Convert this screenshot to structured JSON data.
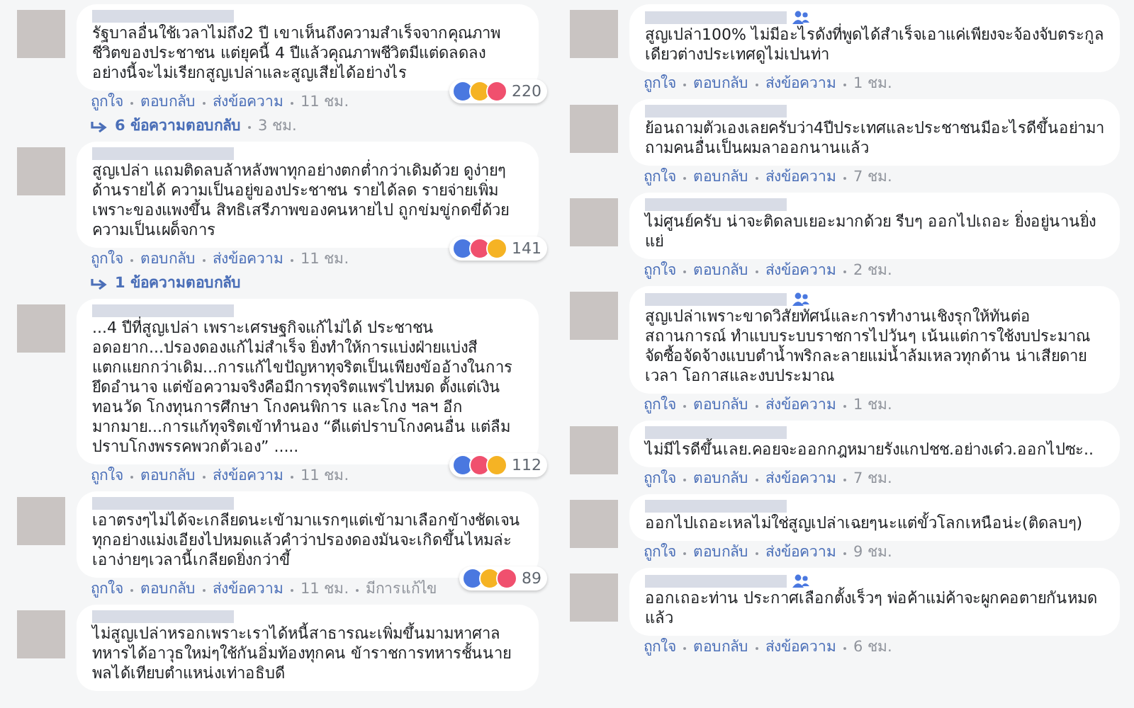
{
  "columns": [
    {
      "comments": [
        {
          "text": "รัฐบาลอื่นใช้เวลาไม่ถึง2 ปี เขาเห็นถึงความสำเร็จจากคุณภาพชีวิตของประชาชน แต่ยุคนี้ 4 ปีแล้วคุณภาพชีวิตมีแต่ดลดลง อย่างนี้จะไม่เรียกสูญเปล่าและสูญเสียได้อย่างไร",
          "member_badge": false,
          "reactions": [
            {
              "kind": "like"
            },
            {
              "kind": "haha"
            },
            {
              "kind": "love"
            }
          ],
          "reaction_count": "220",
          "actions": [
            "ถูกใจ",
            "ตอบกลับ",
            "ส่งข้อความ"
          ],
          "time": "11 ชม.",
          "replies": {
            "label": "6 ข้อความตอบกลับ",
            "time": "3 ชม."
          }
        },
        {
          "text": "สูญเปล่า แถมติดลบล้าหลังพาทุกอย่างตกต่ำกว่าเดิมด้วย ดูง่ายๆด้านรายได้ ความเป็นอยู่ของประชาชน รายได้ลด รายจ่ายเพิ่มเพราะของแพงขึ้น สิทธิเสรีภาพของคนหายไป ถูกข่มขู่กดขี่ด้วยความเป็นเผด็จการ",
          "member_badge": false,
          "reactions": [
            {
              "kind": "like"
            },
            {
              "kind": "love"
            },
            {
              "kind": "haha"
            }
          ],
          "reaction_count": "141",
          "actions": [
            "ถูกใจ",
            "ตอบกลับ",
            "ส่งข้อความ"
          ],
          "time": "11 ชม.",
          "replies": {
            "label": "1 ข้อความตอบกลับ"
          }
        },
        {
          "text": "...4 ปีที่สูญเปล่า เพราะเศรษฐกิจแก้ไม่ได้ ประชาชนอดอยาก...ปรองดองแก้ไม่สำเร็จ ยิ่งทำให้การแบ่งฝ่ายแบ่งสี แตกแยกกว่าเดิม...การแก้ไขปัญหาทุจริตเป็นเพียงข้ออ้างในการยึดอำนาจ แต่ข้อความจริงคือมีการทุจริตแพร่ไปหมด ตั้งแต่เงินทอนวัด โกงทุนการศึกษา โกงคนพิการ และโกง ฯลฯ อีกมากมาย...การแก้ทุจริตเข้าทำนอง “ดีแต่ปราบโกงคนอื่น แต่ลืมปราบโกงพรรคพวกตัวเอง” .....",
          "member_badge": false,
          "reactions": [
            {
              "kind": "like"
            },
            {
              "kind": "love"
            },
            {
              "kind": "haha"
            }
          ],
          "reaction_count": "112",
          "actions": [
            "ถูกใจ",
            "ตอบกลับ",
            "ส่งข้อความ"
          ],
          "time": "11 ชม."
        },
        {
          "text": "เอาตรงๆไม่ได้จะเกลียดนะเข้ามาแรกๆแต่เข้ามาเลือกข้างชัดเจนทุกอย่างแม่งเอียงไปหมดแล้วคำว่าปรองดองมันจะเกิดขึ้นไหมล่ะเอาง่ายๆเวลานี้เกลียดยิ่งกว่าขี้",
          "member_badge": false,
          "reactions": [
            {
              "kind": "like"
            },
            {
              "kind": "haha"
            },
            {
              "kind": "love"
            }
          ],
          "reaction_count": "89",
          "actions": [
            "ถูกใจ",
            "ตอบกลับ",
            "ส่งข้อความ"
          ],
          "time": "11 ชม.",
          "edited": "มีการแก้ไข"
        },
        {
          "text": "ไม่สูญเปล่าหรอกเพราะเราได้หนี้สาธารณะเพิ่มขึ้นมามหาศาล ทหารได้อาวุธใหม่ๆใช้กันอิ่มท้องทุกคน ข้าราชการทหารชั้นนายพลได้เทียบตำแหน่งเท่าอธิบดี",
          "member_badge": false
        }
      ]
    },
    {
      "comments": [
        {
          "text": "สูญเปล่า100% ไม่มีอะไรดังที่พูดได้สำเร็จเอาแค่เพียงจะจ้องจับตระกูลเดียวต่างประเทศดูไม่เปนท่า",
          "member_badge": true,
          "actions": [
            "ถูกใจ",
            "ตอบกลับ",
            "ส่งข้อความ"
          ],
          "time": "1 ชม."
        },
        {
          "text": "ย้อนถามตัวเองเลยครับว่า4ปีประเทศและประชาชนมีอะไรดีขึ้นอย่ามาถามคนอื่นเป็นผมลาออกนานแล้ว",
          "member_badge": false,
          "actions": [
            "ถูกใจ",
            "ตอบกลับ",
            "ส่งข้อความ"
          ],
          "time": "7 ชม."
        },
        {
          "text": "ไม่ศูนย์ครับ น่าจะติดลบเยอะมากด้วย รีบๆ ออกไปเถอะ ยิ่งอยู่นานยิ่งแย่",
          "member_badge": false,
          "actions": [
            "ถูกใจ",
            "ตอบกลับ",
            "ส่งข้อความ"
          ],
          "time": "2 ชม."
        },
        {
          "text": "สูญเปล่าเพราะขาดวิสัยทัศน์และการทำงานเชิงรุกให้ทันต่อสถานการณ์ ทำแบบระบบราชการไปวันๆ เน้นแต่การใช้งบประมาณจัดซื้อจัดจ้างแบบตำน้ำพริกละลายแม่น้ำล้มเหลวทุกด้าน น่าเสียดายเวลา โอกาสและงบประมาณ",
          "member_badge": true,
          "actions": [
            "ถูกใจ",
            "ตอบกลับ",
            "ส่งข้อความ"
          ],
          "time": "1 ชม."
        },
        {
          "text": "ไม่มีไรดีขึ้นเลย.คอยจะออกกฎหมายรังแกปชช.อย่างเด๋ว.ออกไปซะ..",
          "member_badge": false,
          "actions": [
            "ถูกใจ",
            "ตอบกลับ",
            "ส่งข้อความ"
          ],
          "time": "7 ชม."
        },
        {
          "text": "ออกไปเถอะเหลไม่ใช่สูญเปล่าเฉยๆนะแต่ขั้วโลกเหนือน่ะ(ติดลบๆ)",
          "member_badge": false,
          "actions": [
            "ถูกใจ",
            "ตอบกลับ",
            "ส่งข้อความ"
          ],
          "time": "9 ชม."
        },
        {
          "text": "ออกเถอะท่าน ประกาศเลือกตั้งเร็วๆ พ่อค้าแม่ค้าจะผูกคอตายกันหมดแล้ว",
          "member_badge": true,
          "actions": [
            "ถูกใจ",
            "ตอบกลับ",
            "ส่งข้อความ"
          ],
          "time": "6 ชม."
        }
      ]
    }
  ]
}
